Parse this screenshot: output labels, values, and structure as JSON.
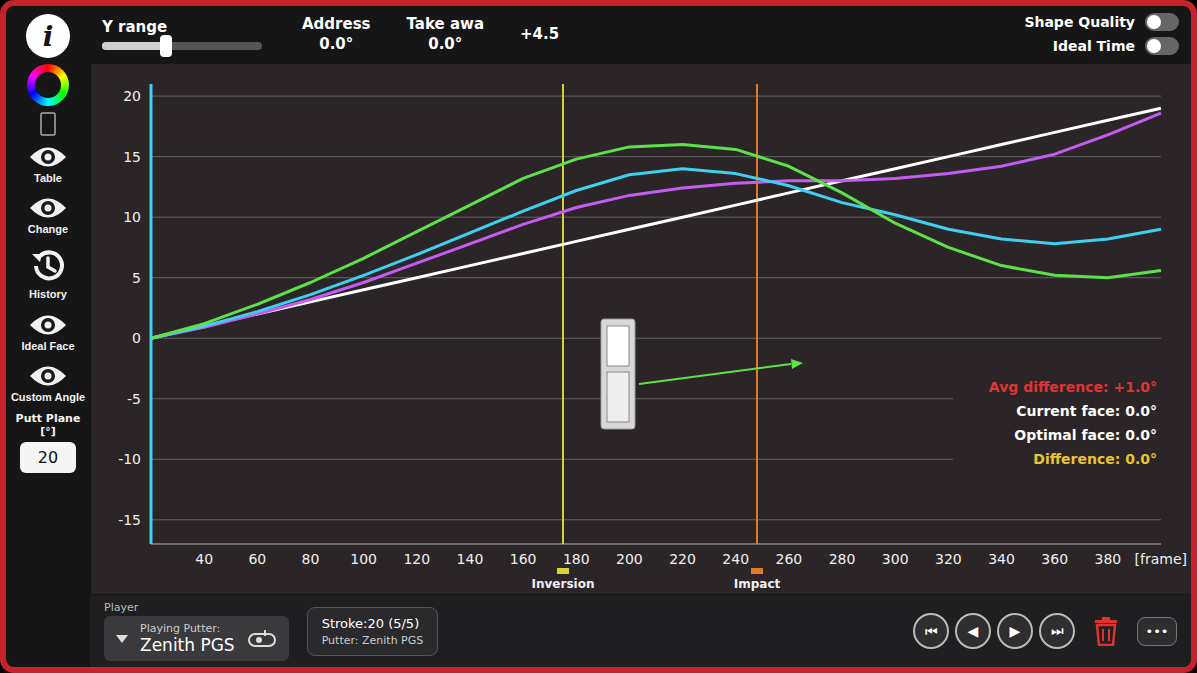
{
  "sidebar": {
    "info": "i",
    "items": [
      {
        "label": "Table",
        "kind": "eye"
      },
      {
        "label": "Change",
        "kind": "eye"
      },
      {
        "label": "History",
        "kind": "history"
      },
      {
        "label": "Ideal Face",
        "kind": "eye"
      },
      {
        "label": "Custom Angle",
        "kind": "eye"
      }
    ],
    "putt_plane": {
      "label": "Putt Plane [°]",
      "value": "20"
    }
  },
  "toolbar": {
    "y_range": {
      "label": "Y range",
      "level": 0.4
    },
    "fields": [
      {
        "label": "Address",
        "value": "0.0°"
      },
      {
        "label": "Take awa",
        "value": "0.0°"
      },
      {
        "label": "",
        "value": "+4.5"
      }
    ],
    "toggles": [
      {
        "label": "Shape Quality",
        "on": false
      },
      {
        "label": "Ideal Time",
        "on": false
      }
    ]
  },
  "chart": {
    "y_ticks": [
      "20",
      "15",
      "10",
      "5",
      "0",
      "-5",
      "-10",
      "-15"
    ],
    "x_ticks": [
      "40",
      "60",
      "80",
      "100",
      "120",
      "140",
      "160",
      "180",
      "200",
      "220",
      "240",
      "260",
      "280",
      "300",
      "320",
      "340",
      "360",
      "380"
    ],
    "x_unit": "[frame]",
    "x_values": [
      20,
      40,
      60,
      80,
      100,
      120,
      140,
      160,
      180,
      200,
      220,
      240,
      260,
      280,
      300,
      320,
      340,
      360,
      380,
      400
    ],
    "series": [
      {
        "color": "#ffffff",
        "values": [
          0,
          1,
          2,
          3,
          4,
          5,
          6,
          7,
          8,
          9,
          10,
          11,
          12,
          13,
          14,
          15,
          16,
          17,
          18,
          19
        ]
      },
      {
        "color": "#c45cf0",
        "values": [
          0,
          0.9,
          2,
          3.2,
          4.6,
          6.2,
          7.8,
          9.4,
          10.8,
          11.8,
          12.4,
          12.8,
          13,
          13,
          13.2,
          13.6,
          14.2,
          15.2,
          16.8,
          18.6
        ]
      },
      {
        "color": "#3fd0f0",
        "values": [
          0,
          1,
          2.2,
          3.6,
          5.2,
          6.9,
          8.7,
          10.5,
          12.2,
          13.5,
          14,
          13.6,
          12.6,
          11.2,
          10.2,
          9,
          8.2,
          7.8,
          8.2,
          9
        ]
      },
      {
        "color": "#5de04a",
        "values": [
          0,
          1.2,
          2.8,
          4.6,
          6.6,
          8.8,
          11,
          13.2,
          14.8,
          15.8,
          16,
          15.6,
          14.2,
          12,
          9.5,
          7.5,
          6,
          5.2,
          5,
          5.6
        ]
      }
    ],
    "markers": [
      {
        "label": "Inversion",
        "frame": 175,
        "color": "#d8d23a"
      },
      {
        "label": "Impact",
        "frame": 248,
        "color": "#e07a2a"
      }
    ],
    "readouts": [
      {
        "label": "Avg difference: +1.0°",
        "color": "#e03434"
      },
      {
        "label": "Current face: 0.0°",
        "color": "#ffffff"
      },
      {
        "label": "Optimal face: 0.0°",
        "color": "#ffffff"
      },
      {
        "label": "Difference: 0.0°",
        "color": "#e8c531"
      }
    ]
  },
  "player": {
    "label": "Player",
    "putter_label": "Playing Putter:",
    "putter": "Zenith PGS"
  },
  "stroke": {
    "title": "Stroke:20 (5/5)",
    "putter": "Putter: Zenith PGS"
  },
  "controls": [
    "⏮",
    "◀",
    "▶",
    "⏭"
  ],
  "more": "•••"
}
